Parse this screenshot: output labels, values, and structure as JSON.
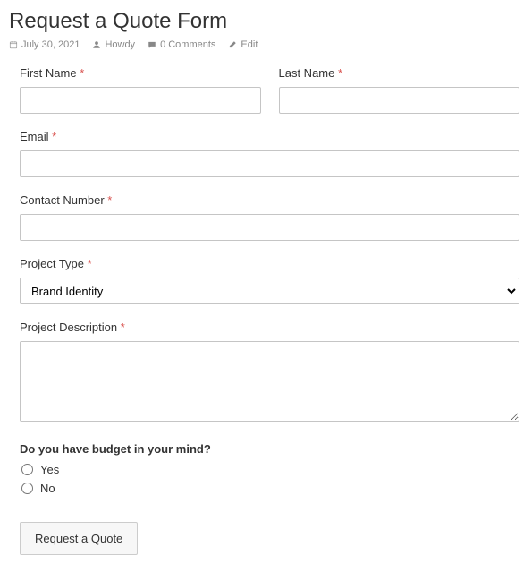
{
  "header": {
    "title": "Request a Quote Form",
    "meta": {
      "date": "July 30, 2021",
      "author": "Howdy",
      "comments": "0 Comments",
      "edit": "Edit"
    }
  },
  "form": {
    "first_name": {
      "label": "First Name"
    },
    "last_name": {
      "label": "Last Name"
    },
    "email": {
      "label": "Email"
    },
    "contact_number": {
      "label": "Contact Number"
    },
    "project_type": {
      "label": "Project Type",
      "selected": "Brand Identity"
    },
    "project_description": {
      "label": "Project Description"
    },
    "budget": {
      "legend": "Do you have budget in your mind?",
      "option_yes": "Yes",
      "option_no": "No"
    },
    "submit_label": "Request a Quote",
    "required_mark": "*"
  }
}
